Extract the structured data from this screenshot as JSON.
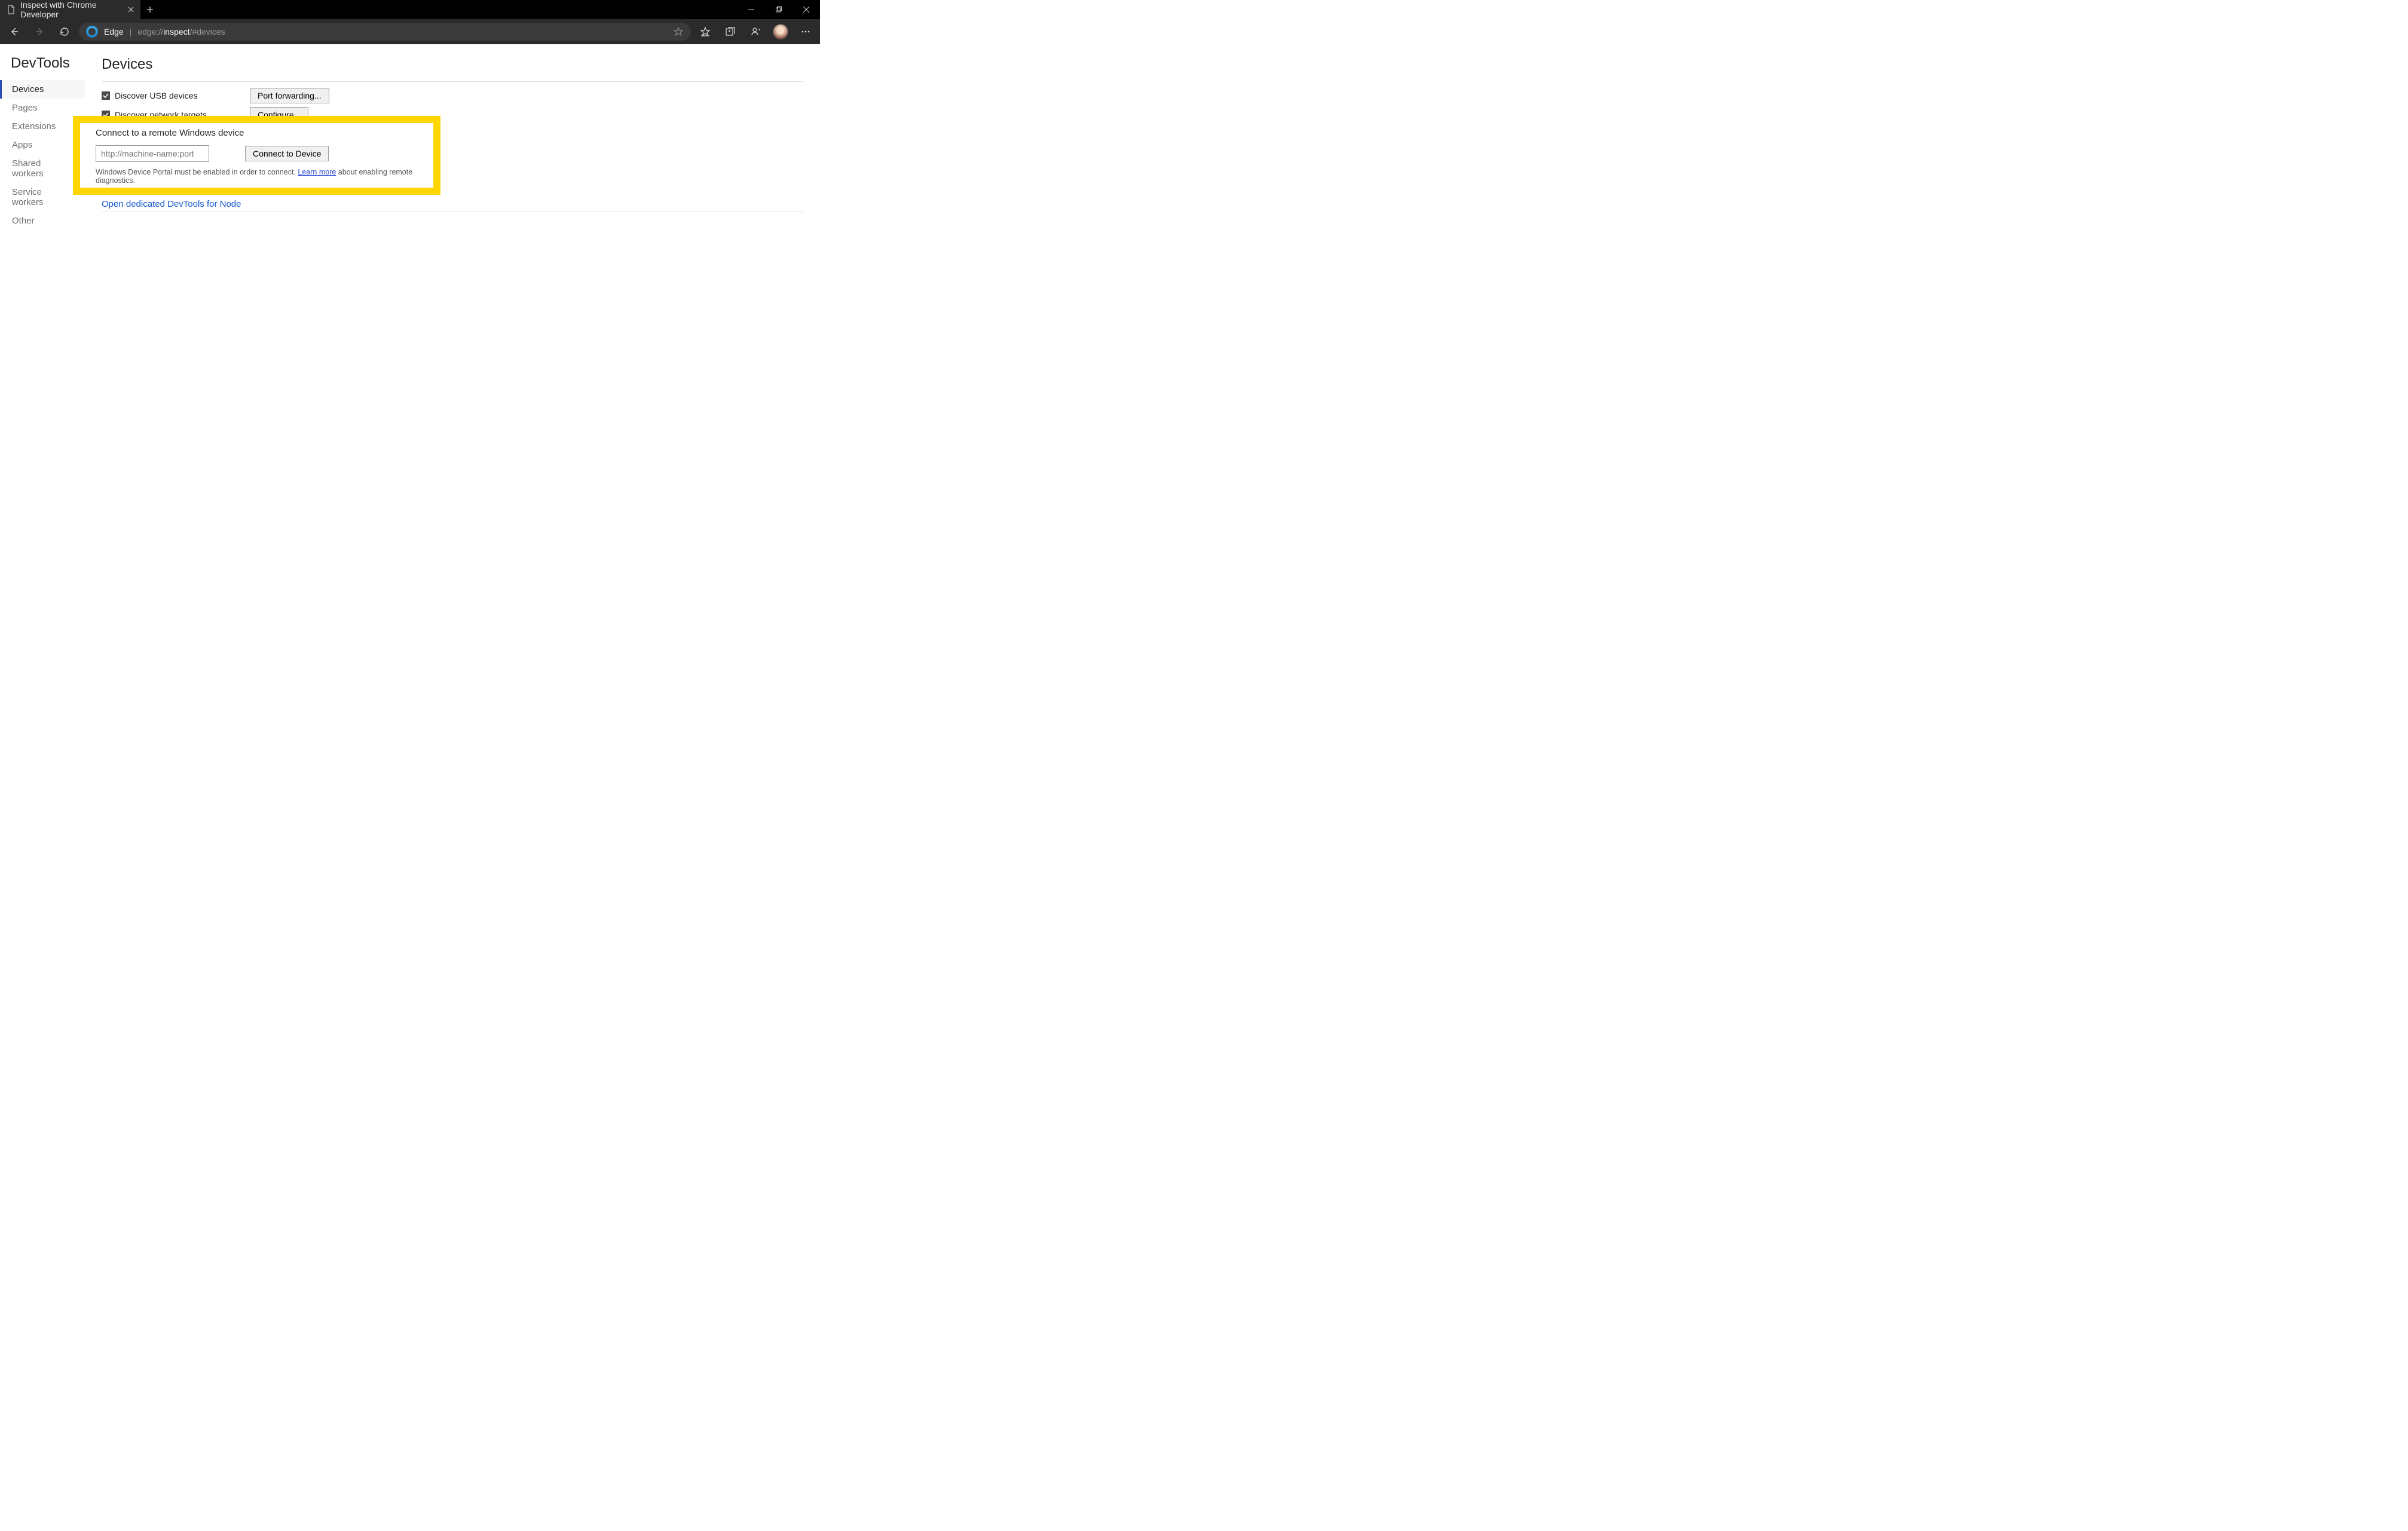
{
  "tab": {
    "title": "Inspect with Chrome Developer"
  },
  "address": {
    "browser_label": "Edge",
    "url_prefix": "edge://",
    "url_bold": "inspect",
    "url_suffix": "/#devices"
  },
  "sidebar": {
    "title": "DevTools",
    "items": [
      "Devices",
      "Pages",
      "Extensions",
      "Apps",
      "Shared workers",
      "Service workers",
      "Other"
    ],
    "active_index": 0
  },
  "main": {
    "heading": "Devices",
    "discover_usb": {
      "label": "Discover USB devices",
      "checked": true
    },
    "port_forwarding_button": "Port forwarding...",
    "discover_network": {
      "label": "Discover network targets",
      "checked": true
    },
    "configure_button": "Configure...",
    "node_link": "Open dedicated DevTools for Node"
  },
  "remote": {
    "heading": "Connect to a remote Windows device",
    "placeholder": "http://machine-name:port",
    "connect_button": "Connect to Device",
    "hint_before": "Windows Device Portal must be enabled in order to connect. ",
    "hint_link": "Learn more",
    "hint_after": " about enabling remote diagnostics."
  }
}
